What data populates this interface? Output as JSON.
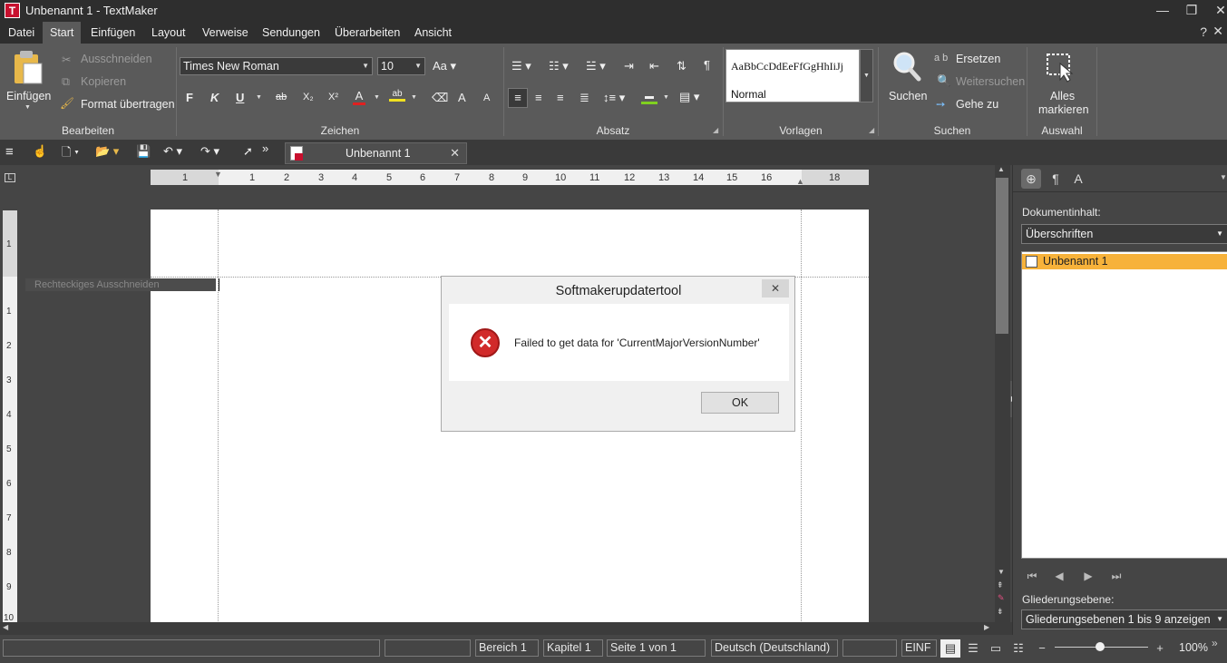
{
  "window": {
    "app_icon_letter": "T",
    "title": "Unbenannt 1 - TextMaker",
    "controls": {
      "minimize": "—",
      "restore": "❐",
      "close": "✕"
    }
  },
  "menu": {
    "items": [
      "Datei",
      "Start",
      "Einfügen",
      "Layout",
      "Verweise",
      "Sendungen",
      "Überarbeiten",
      "Ansicht"
    ],
    "active": "Start",
    "help": "?",
    "close": "✕"
  },
  "ribbon": {
    "bearbeiten": {
      "paste": "Einfügen",
      "cut": "Ausschneiden",
      "copy": "Kopieren",
      "format_painter": "Format übertragen",
      "label": "Bearbeiten"
    },
    "zeichen": {
      "font": "Times New Roman",
      "size": "10",
      "bold": "F",
      "italic": "K",
      "underline": "U",
      "strike": "ab",
      "subscript": "X₂",
      "superscript": "X²",
      "label": "Zeichen"
    },
    "absatz": {
      "label": "Absatz",
      "pilcrow": "¶"
    },
    "vorlagen": {
      "preview": "AaBbCcDdEeFfGgHhIiJj",
      "style": "Normal",
      "label": "Vorlagen"
    },
    "suchen": {
      "search": "Suchen",
      "replace": "Ersetzen",
      "replace_prefix": "a b",
      "find_next": "Weitersuchen",
      "goto": "Gehe zu",
      "label": "Suchen"
    },
    "auswahl": {
      "select_all_line1": "Alles",
      "select_all_line2": "markieren",
      "label": "Auswahl"
    }
  },
  "toolbar": {
    "document_tab": "Unbenannt 1",
    "tab_close": "✕"
  },
  "ruler": {
    "ticks": [
      "1",
      "1",
      "2",
      "3",
      "4",
      "5",
      "6",
      "7",
      "8",
      "9",
      "10",
      "11",
      "12",
      "13",
      "14",
      "15",
      "16",
      "18"
    ],
    "vticks": [
      "1",
      "1",
      "2",
      "3",
      "4",
      "5",
      "6",
      "7",
      "8",
      "9",
      "10"
    ]
  },
  "document": {
    "ghost_text": "Rechteckiges Ausschneiden"
  },
  "dialog": {
    "title": "Softmakerupdatertool",
    "close": "✕",
    "icon": "✕",
    "message": "Failed to get data for 'CurrentMajorVersionNumber'",
    "ok": "OK"
  },
  "side_panel": {
    "heading": "Dokumentinhalt:",
    "select": "Überschriften",
    "outline_items": [
      "Unbenannt 1"
    ],
    "levels_label": "Gliederungsebene:",
    "levels_select": "Gliederungsebenen 1 bis 9 anzeigen"
  },
  "status": {
    "bereich": "Bereich 1",
    "kapitel": "Kapitel 1",
    "seite": "Seite 1 von 1",
    "sprache": "Deutsch (Deutschland)",
    "mode": "EINF",
    "zoom": "100%",
    "zoom_minus": "−",
    "zoom_plus": "+"
  }
}
